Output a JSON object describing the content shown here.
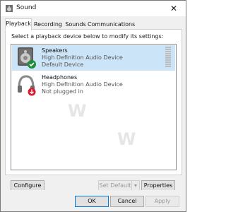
{
  "window": {
    "title": "Sound",
    "close_glyph": "✕"
  },
  "tabs": [
    {
      "label": "Playback",
      "active": true
    },
    {
      "label": "Recording",
      "active": false
    },
    {
      "label": "Sounds",
      "active": false
    },
    {
      "label": "Communications",
      "active": false
    }
  ],
  "panel": {
    "instruction": "Select a playback device below to modify its settings:",
    "devices": [
      {
        "name": "Speakers",
        "description": "High Definition Audio Device",
        "status": "Default Device",
        "icon": "speaker-icon",
        "badge": "default-check-icon",
        "selected": true
      },
      {
        "name": "Headphones",
        "description": "High Definition Audio Device",
        "status": "Not plugged in",
        "icon": "headphones-icon",
        "badge": "unplugged-arrow-icon",
        "selected": false
      }
    ]
  },
  "buttons": {
    "configure": "Configure",
    "set_default": "Set Default",
    "properties": "Properties",
    "ok": "OK",
    "cancel": "Cancel",
    "apply": "Apply"
  },
  "colors": {
    "selection": "#cce4f7",
    "check_badge": "#1e8c3a",
    "unplugged_badge": "#d7192a",
    "accent": "#0078d7"
  }
}
